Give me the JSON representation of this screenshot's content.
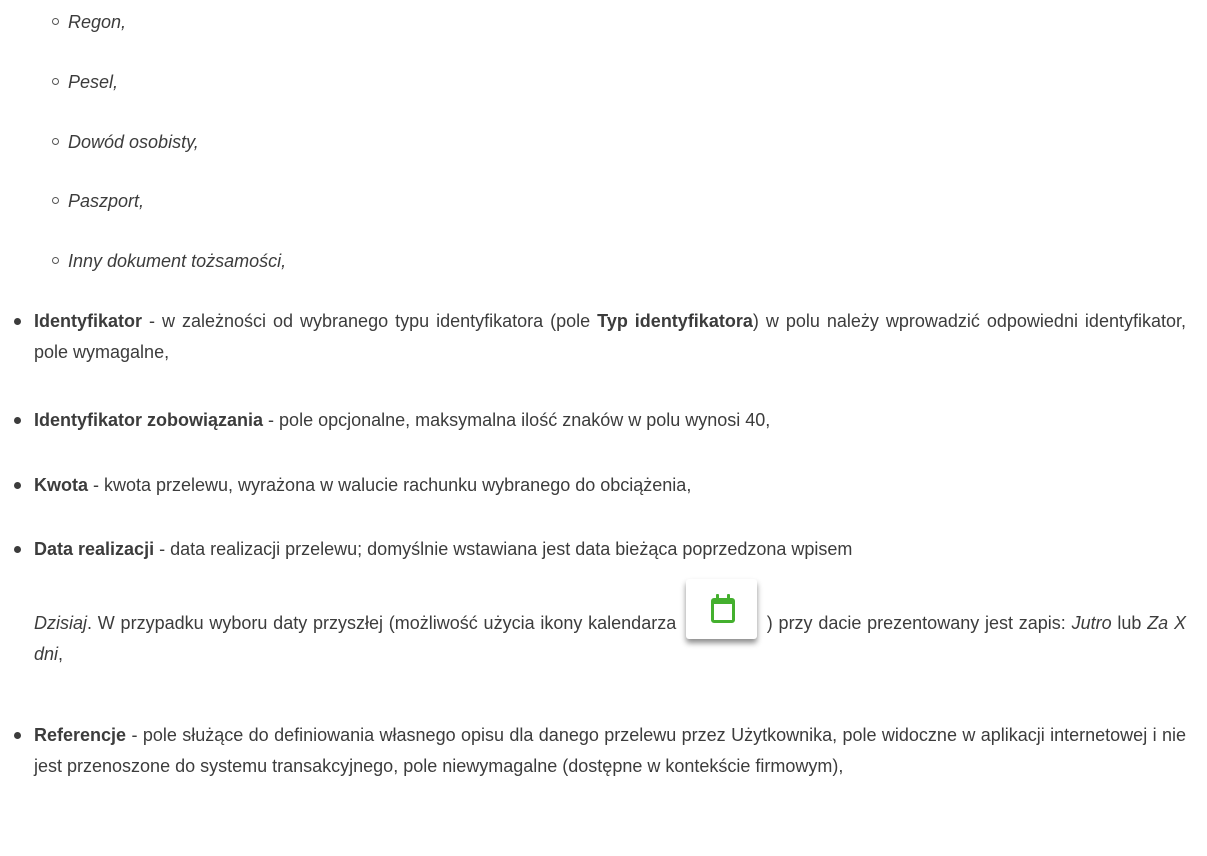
{
  "sub_items": [
    "Regon,",
    "Pesel,",
    "Dowód osobisty,",
    "Paszport,",
    "Inny dokument tożsamości,"
  ],
  "items": {
    "identyfikator": {
      "term": "Identyfikator",
      "t1": " - w zależności od wybranego typu identyfikatora (pole ",
      "bold2": "Typ identyfikatora",
      "t2": ") w polu należy wprowadzić odpowiedni identyfikator, pole wymagalne,"
    },
    "identyfikator_zobowiazania": {
      "term": "Identyfikator zobowiązania",
      "t1": " - pole opcjonalne, maksymalna ilość znaków w polu wynosi 40,"
    },
    "kwota": {
      "term": "Kwota",
      "t1": " - kwota przelewu, wyrażona w walucie rachunku wybranego do obciążenia,"
    },
    "data_realizacji": {
      "term": "Data realizacji",
      "t1": " - data realizacji przelewu; domyślnie wstawiana jest data bieżąca poprzedzona wpisem",
      "it1": "Dzisiaj",
      "t2": ". W przypadku wyboru daty przyszłej (możliwość użycia ikony kalendarza",
      "t3": ") przy dacie prezentowany jest zapis: ",
      "it2": "Jutro",
      "t4": " lub ",
      "it3": "Za X dni",
      "t5": ","
    },
    "referencje": {
      "term": "Referencje",
      "t1": " - pole służące do definiowania własnego opisu dla danego przelewu przez Użytkownika, pole widoczne w aplikacji internetowej i nie jest przenoszone do systemu transakcyjnego, pole niewymagalne (dostępne w kontekście firmowym),"
    }
  },
  "icons": {
    "calendar": "calendar-icon",
    "calendar_color": "#44b02e"
  }
}
